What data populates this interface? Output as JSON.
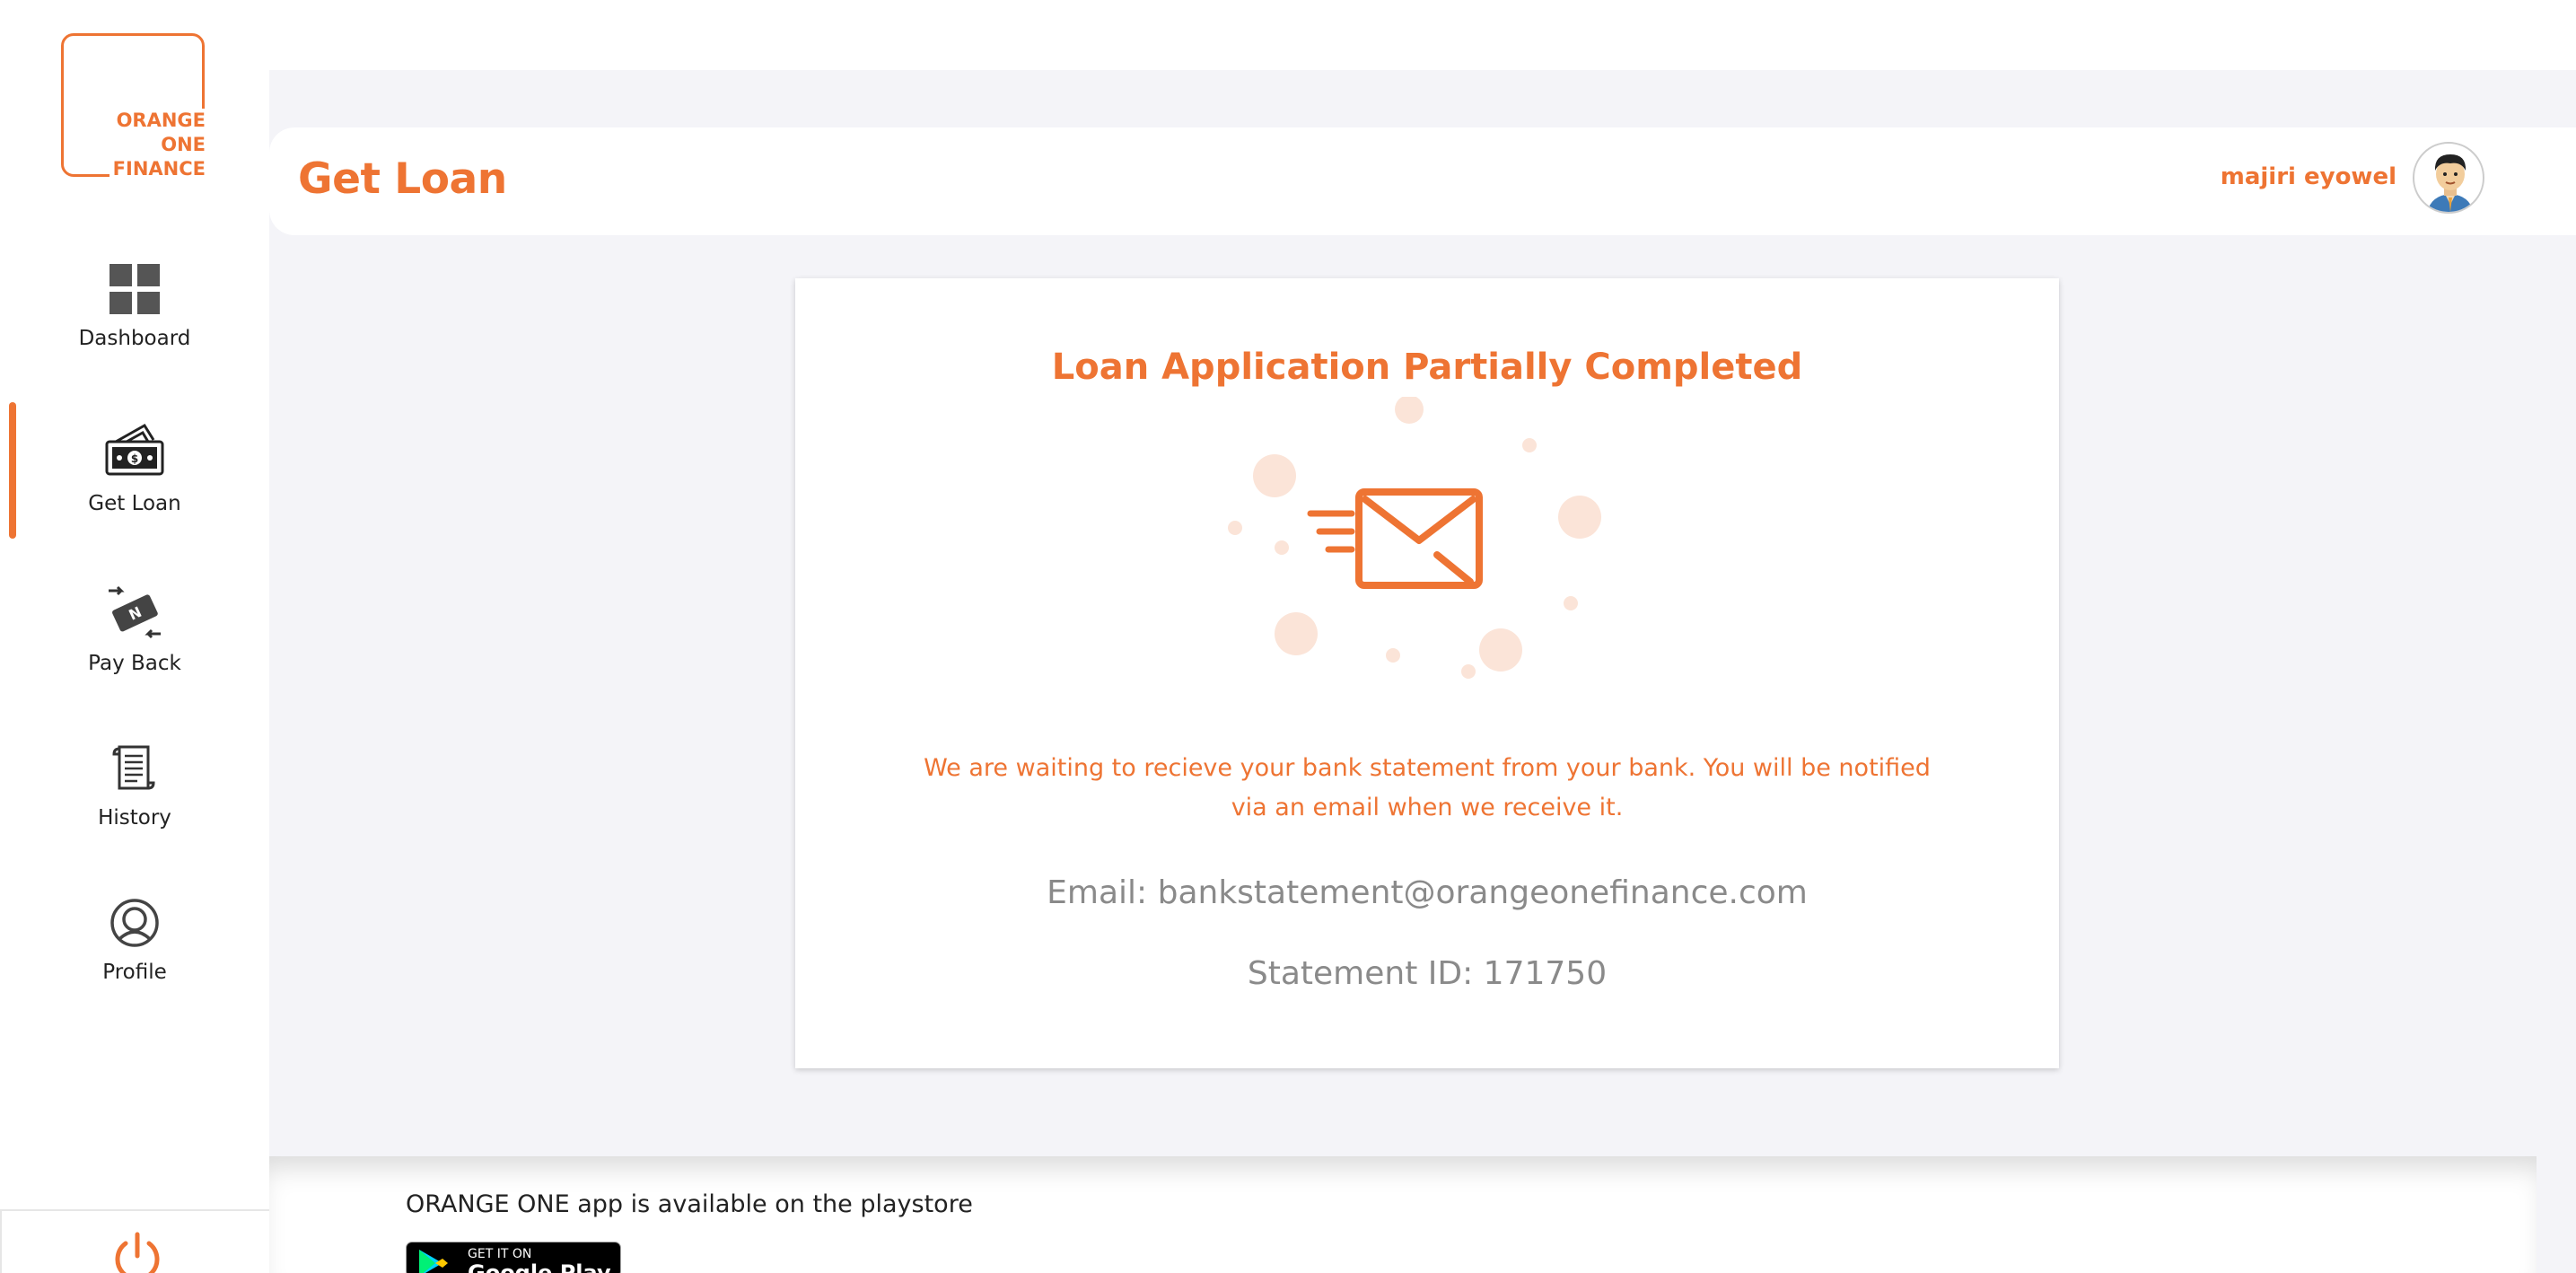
{
  "brand": {
    "logo_lines": [
      "ORANGE",
      "ONE",
      "FINANCE"
    ],
    "accent_color": "#ee7433"
  },
  "sidebar": {
    "items": [
      {
        "label": "Dashboard",
        "icon": "dashboard-grid-icon"
      },
      {
        "label": "Get Loan",
        "icon": "money-cash-icon",
        "active": true
      },
      {
        "label": "Pay Back",
        "icon": "payback-transfer-icon"
      },
      {
        "label": "History",
        "icon": "scroll-history-icon"
      },
      {
        "label": "Profile",
        "icon": "user-profile-icon"
      }
    ],
    "logout_icon": "power-icon"
  },
  "header": {
    "title": "Get Loan",
    "username": "majiri eyowel"
  },
  "card": {
    "title": "Loan Application Partially Completed",
    "illustration_icon": "envelope-send-icon",
    "message": "We are waiting to recieve your bank statement from your bank. You will be notified via an email when we receive it.",
    "email_line": "Email: bankstatement@orangeonefinance.com",
    "statement_line": "Statement ID: 171750"
  },
  "footer": {
    "text": "ORANGE ONE app is available on the playstore",
    "badge_small": "GET IT ON",
    "badge_big": "Google Play"
  }
}
